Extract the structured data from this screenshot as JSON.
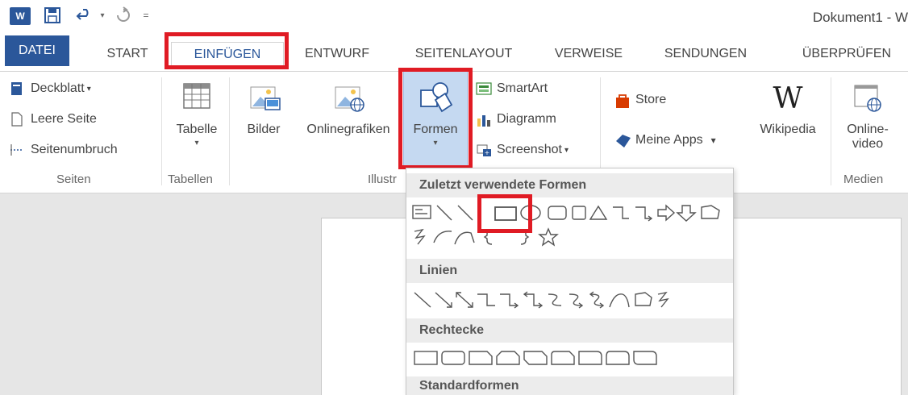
{
  "titlebar": {
    "app_logo": "W",
    "document_title": "Dokument1 - W",
    "qat": [
      {
        "icon": "save-icon"
      },
      {
        "icon": "undo-icon"
      },
      {
        "icon": "redo-icon"
      },
      {
        "icon": "customize-qat-icon"
      }
    ]
  },
  "tabs": [
    {
      "label": "DATEI"
    },
    {
      "label": "START"
    },
    {
      "label": "EINFÜGEN"
    },
    {
      "label": "ENTWURF"
    },
    {
      "label": "SEITENLAYOUT"
    },
    {
      "label": "VERWEISE"
    },
    {
      "label": "SENDUNGEN"
    },
    {
      "label": "ÜBERPRÜFEN"
    }
  ],
  "ribbon": {
    "seiten": {
      "group_label": "Seiten",
      "deckblatt": "Deckblatt",
      "leere_seite": "Leere Seite",
      "seitenumbruch": "Seitenumbruch"
    },
    "tabellen": {
      "group_label": "Tabellen",
      "tabelle": "Tabelle"
    },
    "illustrationen": {
      "group_label": "Illustr",
      "bilder": "Bilder",
      "onlinegrafiken": "Onlinegrafiken",
      "formen": "Formen",
      "smartart": "SmartArt",
      "diagramm": "Diagramm",
      "screenshot": "Screenshot"
    },
    "apps": {
      "store": "Store",
      "meine_apps": "Meine Apps",
      "wikipedia": "Wikipedia",
      "wikipedia_logo": "W"
    },
    "medien": {
      "group_label": "Medien",
      "onlinevideo_line1": "Online-",
      "onlinevideo_line2": "video"
    }
  },
  "shapes_dropdown": {
    "recent_header": "Zuletzt verwendete Formen",
    "lines_header": "Linien",
    "rectangles_header": "Rechtecke",
    "basic_header": "Standardformen"
  },
  "colors": {
    "accent": "#2b579a",
    "highlight_red": "#e01b24",
    "selected_button": "#c5d9f1"
  }
}
